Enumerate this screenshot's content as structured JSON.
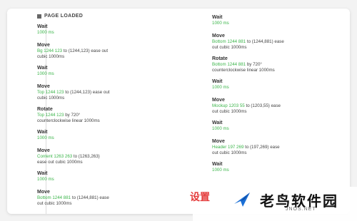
{
  "header": {
    "title": "PAGE LOADED"
  },
  "left": [
    {
      "title": "Wait",
      "value": "1000 ms"
    },
    {
      "title": "Move",
      "line1_green": "Bg 1244 123",
      "line1_rest": " to (1244,123) ease out",
      "line2": "cubic 1000ms"
    },
    {
      "title": "Wait",
      "value": "1000 ms"
    },
    {
      "title": "Move",
      "line1_green": "Top 1244 123",
      "line1_rest": " to (1244,123) ease out",
      "line2": "cubic 1000ms"
    },
    {
      "title": "Rotate",
      "line1_green": "Top 1244 123",
      "line1_rest": " by 720°",
      "line2": "counterclockwise linear 1000ms"
    },
    {
      "title": "Wait",
      "value": "1000 ms"
    },
    {
      "title": "Move",
      "line1_green": "Content 1263 263",
      "line1_rest": " to (1263,263)",
      "line2": "ease out cubic 1000ms"
    },
    {
      "title": "Wait",
      "value": "1000 ms"
    },
    {
      "title": "Move",
      "line1_green": "Bottom 1244 881",
      "line1_rest": " to (1244,881) ease",
      "line2": "out cubic 1000ms"
    }
  ],
  "right": [
    {
      "title": "Wait",
      "value": "1000 ms"
    },
    {
      "title": "Move",
      "line1_green": "Bottom 1244 881",
      "line1_rest": " to (1244,881) ease",
      "line2": "out cubic 1000ms"
    },
    {
      "title": "Rotate",
      "line1_green": "Bottom 1244 881",
      "line1_rest": " by 720°",
      "line2": "counterclockwise linear 1000ms"
    },
    {
      "title": "Wait",
      "value": "1000 ms"
    },
    {
      "title": "Move",
      "line1_green": "Mockup 1203 55",
      "line1_rest": " to (1203,55) ease",
      "line2": "out cubic 1000ms"
    },
    {
      "title": "Wait",
      "value": "1000 ms"
    },
    {
      "title": "Move",
      "line1_green": "Header 197 269",
      "line1_rest": " to (197,269) ease",
      "line2": "out cubic 1000ms"
    },
    {
      "title": "Wait",
      "value": "1000 ms"
    }
  ],
  "watermark": {
    "red": "设置",
    "text": "老鸟软件园",
    "sub": "JNOS.NET"
  }
}
